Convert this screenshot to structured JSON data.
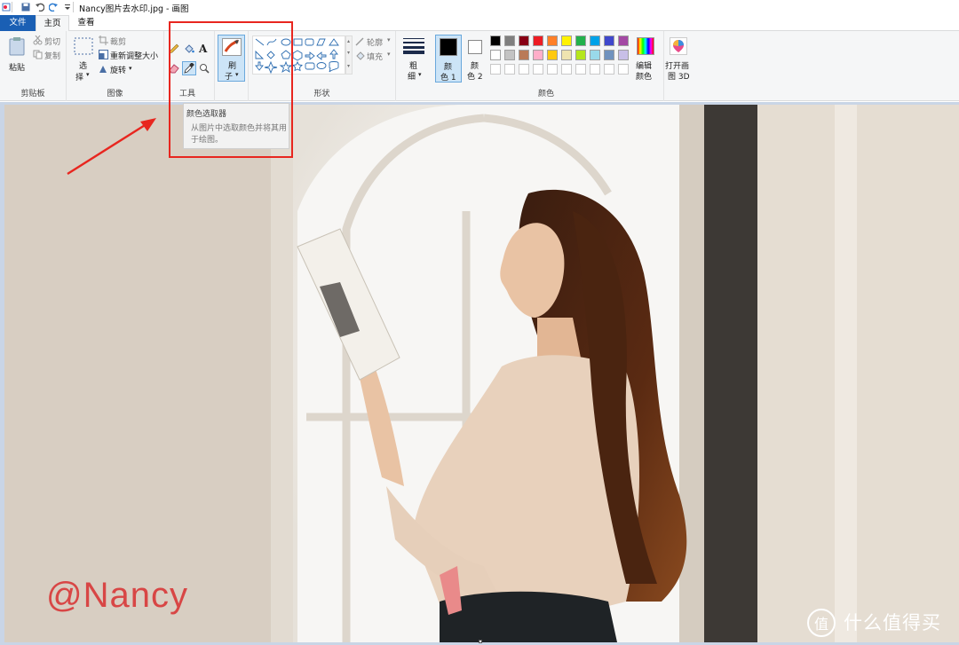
{
  "window": {
    "title": "Nancy图片去水印.jpg - 画图"
  },
  "tabs": {
    "file": "文件",
    "home": "主页",
    "view": "查看"
  },
  "ribbon": {
    "clipboard": {
      "paste": "粘贴",
      "cut": "剪切",
      "copy": "复制",
      "group_label": "剪贴板"
    },
    "image": {
      "select_line1": "选",
      "select_line2": "择",
      "crop": "裁剪",
      "resize": "重新调整大小",
      "rotate": "旋转",
      "group_label": "图像"
    },
    "tools": {
      "group_label": "工具",
      "text_icon": "A"
    },
    "brushes": {
      "line1": "刷",
      "line2": "子"
    },
    "shapes": {
      "outline": "轮廓",
      "fill": "填充",
      "group_label": "形状"
    },
    "size": {
      "line1": "粗",
      "line2": "细"
    },
    "color1": {
      "line1": "颜",
      "line2": "色 1"
    },
    "color2": {
      "line1": "颜",
      "line2": "色 2"
    },
    "colors": {
      "group_label": "颜色",
      "row1": [
        "#000000",
        "#7f7f7f",
        "#880015",
        "#ed1c24",
        "#ff7f27",
        "#fff200",
        "#22b14c",
        "#00a2e8",
        "#3f48cc",
        "#a349a4"
      ],
      "row2": [
        "#ffffff",
        "#c3c3c3",
        "#b97a57",
        "#ffaec9",
        "#ffc90e",
        "#efe4b0",
        "#b5e61d",
        "#99d9ea",
        "#7092be",
        "#c8bfe7"
      ]
    },
    "edit_colors": {
      "line1": "编辑",
      "line2": "颜色"
    },
    "paint3d": {
      "line1": "打开画",
      "line2": "图 3D"
    }
  },
  "tooltip": {
    "title": "颜色选取器",
    "body": "从图片中选取颜色并将其用于绘图。"
  },
  "canvas": {
    "watermark": "@Nancy",
    "site_logo": "什么值得买"
  },
  "accent": {
    "highlight": "#e8261f",
    "file_tab": "#1a5fb4"
  }
}
